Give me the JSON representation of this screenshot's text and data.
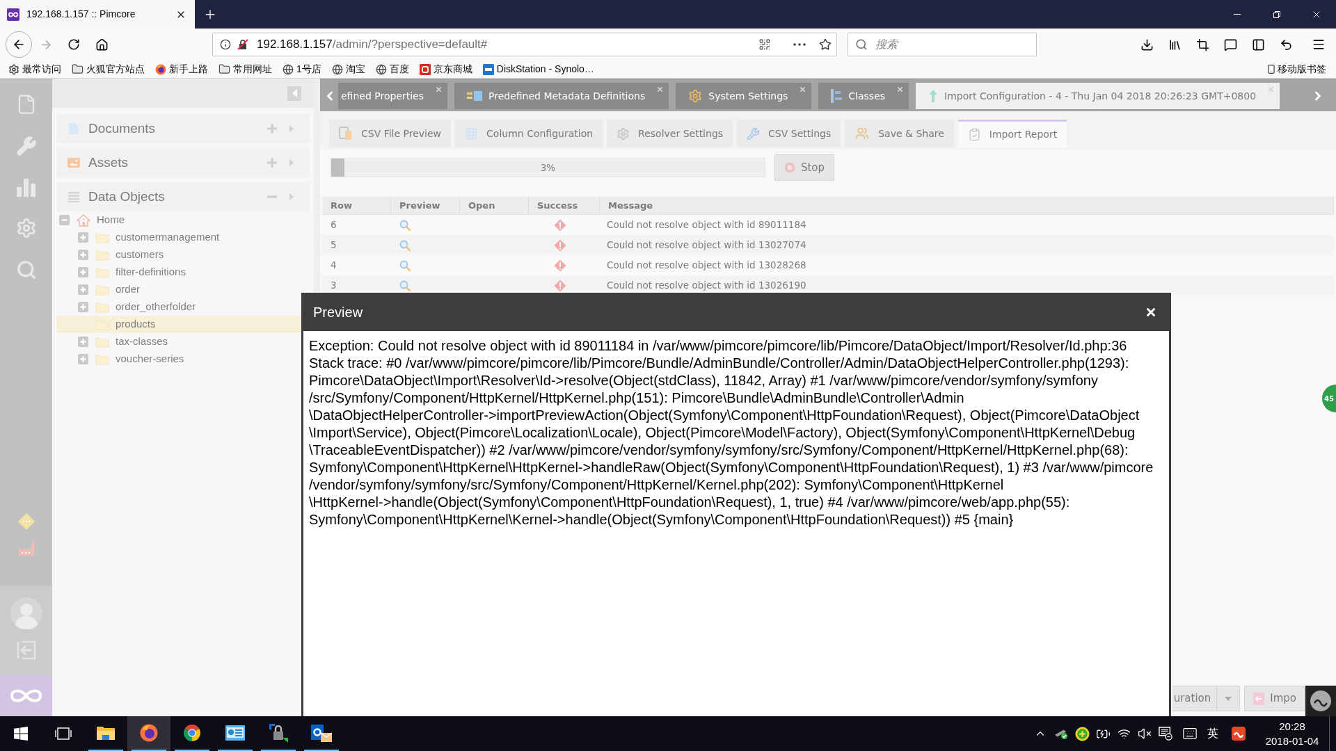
{
  "browser": {
    "tabs": [
      {
        "title": "192.168.1.157 :: Pimcore",
        "selected": true
      }
    ],
    "address": {
      "host": "192.168.1.157",
      "path": "/admin/?perspective=default#"
    },
    "search": {
      "placeholder": "搜索"
    },
    "bookmarks": [
      {
        "label": "最常访问",
        "kind": "gear"
      },
      {
        "label": "火狐官方站点",
        "kind": "folder"
      },
      {
        "label": "新手上路",
        "kind": "browser"
      },
      {
        "label": "常用网址",
        "kind": "folder"
      },
      {
        "label": "1号店",
        "kind": "globe"
      },
      {
        "label": "淘宝",
        "kind": "globe"
      },
      {
        "label": "百度",
        "kind": "globe"
      },
      {
        "label": "京东商城",
        "kind": "shop"
      },
      {
        "label": "DiskStation - Synolo…",
        "kind": "nas"
      }
    ],
    "mobile_bookmarks": "移动版书签"
  },
  "tree_panel": {
    "sections": [
      {
        "title": "Documents",
        "kind": "documents",
        "expanded": false
      },
      {
        "title": "Assets",
        "kind": "assets",
        "expanded": false
      },
      {
        "title": "Data Objects",
        "kind": "objects",
        "expanded": true
      }
    ],
    "tree": [
      {
        "label": "Home",
        "kind": "home",
        "expanded": true,
        "leaf": false,
        "selected": false,
        "children": [
          {
            "label": "customermanagement",
            "kind": "folder",
            "expanded": false,
            "leaf": false,
            "selected": false
          },
          {
            "label": "customers",
            "kind": "folder",
            "expanded": false,
            "leaf": false,
            "selected": false
          },
          {
            "label": "filter-definitions",
            "kind": "folder",
            "expanded": false,
            "leaf": false,
            "selected": false
          },
          {
            "label": "order",
            "kind": "folder",
            "expanded": false,
            "leaf": false,
            "selected": false
          },
          {
            "label": "order_otherfolder",
            "kind": "folder",
            "expanded": false,
            "leaf": false,
            "selected": false
          },
          {
            "label": "products",
            "kind": "folder",
            "leaf": true,
            "selected": true
          },
          {
            "label": "tax-classes",
            "kind": "folder",
            "expanded": false,
            "leaf": false,
            "selected": false
          },
          {
            "label": "voucher-series",
            "kind": "folder",
            "expanded": false,
            "leaf": false,
            "selected": false
          }
        ]
      }
    ]
  },
  "main_tabs": [
    {
      "title": "efined Properties",
      "kind": "text",
      "selected": false
    },
    {
      "title": "Predefined Metadata Definitions",
      "kind": "metadata",
      "selected": false
    },
    {
      "title": "System Settings",
      "kind": "settings",
      "selected": false
    },
    {
      "title": "Classes",
      "kind": "classes",
      "selected": false
    },
    {
      "title": "Import Configuration - 4 - Thu Jan 04 2018 20:26:23 GMT+0800",
      "kind": "import",
      "selected": true
    }
  ],
  "sub_tabs": [
    {
      "label": "CSV File Preview",
      "kind": "preview",
      "selected": false
    },
    {
      "label": "Column Configuration",
      "kind": "columns",
      "selected": false
    },
    {
      "label": "Resolver Settings",
      "kind": "resolver",
      "selected": false
    },
    {
      "label": "CSV Settings",
      "kind": "csv",
      "selected": false
    },
    {
      "label": "Save & Share",
      "kind": "share",
      "selected": false
    },
    {
      "label": "Import Report",
      "kind": "report",
      "selected": true
    }
  ],
  "progress": {
    "level": 0.03,
    "reading": "3%"
  },
  "stop_button": "Stop",
  "report": {
    "columns": [
      "Row",
      "Preview",
      "Open",
      "Success",
      "Message"
    ],
    "rows": [
      {
        "row": "6",
        "success": false,
        "message": "Could not resolve object with id 89011184"
      },
      {
        "row": "5",
        "success": false,
        "message": "Could not resolve object with id 13027074"
      },
      {
        "row": "4",
        "success": false,
        "message": "Could not resolve object with id 13028268"
      },
      {
        "row": "3",
        "success": false,
        "message": "Could not resolve object with id 13026190"
      }
    ]
  },
  "dialog": {
    "title": "Preview",
    "lines": [
      "Exception: Could not resolve object with id 89011184 in /var/www/pimcore/pimcore/lib/Pimcore/DataObject/Import/Resolver/Id.php:36",
      "Stack trace: #0 /var/www/pimcore/pimcore/lib/Pimcore/Bundle/AdminBundle/Controller/Admin/DataObjectHelperController.php(1293):",
      "Pimcore\\DataObject\\Import\\Resolver\\Id->resolve(Object(stdClass), 11842, Array) #1 /var/www/pimcore/vendor/symfony/symfony",
      "/src/Symfony/Component/HttpKernel/HttpKernel.php(151): Pimcore\\Bundle\\AdminBundle\\Controller\\Admin",
      "\\DataObjectHelperController->importPreviewAction(Object(Symfony\\Component\\HttpFoundation\\Request), Object(Pimcore\\DataObject",
      "\\Import\\Service), Object(Pimcore\\Localization\\Locale), Object(Pimcore\\Model\\Factory), Object(Symfony\\Component\\HttpKernel\\Debug",
      "\\TraceableEventDispatcher)) #2 /var/www/pimcore/vendor/symfony/symfony/src/Symfony/Component/HttpKernel/HttpKernel.php(68):",
      "Symfony\\Component\\HttpKernel\\HttpKernel->handleRaw(Object(Symfony\\Component\\HttpFoundation\\Request), 1) #3 /var/www/pimcore",
      "/vendor/symfony/symfony/src/Symfony/Component/HttpKernel/Kernel.php(202): Symfony\\Component\\HttpKernel",
      "\\HttpKernel->handle(Object(Symfony\\Component\\HttpFoundation\\Request), 1, true) #4 /var/www/pimcore/web/app.php(55):",
      "Symfony\\Component\\HttpKernel\\Kernel->handle(Object(Symfony\\Component\\HttpFoundation\\Request)) #5 {main}"
    ]
  },
  "footer_buttons": [
    {
      "label": "uration",
      "kind": "split"
    },
    {
      "label": "Impo",
      "kind": "import"
    }
  ],
  "side_badge": "45",
  "taskbar": {
    "apps": [
      {
        "kind": "explorer",
        "running": true,
        "selected": false
      },
      {
        "kind": "firefox",
        "running": true,
        "selected": true
      },
      {
        "kind": "chrome",
        "running": true,
        "selected": false
      },
      {
        "kind": "control-panel",
        "running": true,
        "selected": false
      },
      {
        "kind": "remote",
        "running": true,
        "selected": false
      },
      {
        "kind": "outlook",
        "running": true,
        "selected": false
      }
    ],
    "ime": "英",
    "clock": {
      "time": "20:28",
      "date": "2018-01-04"
    }
  }
}
